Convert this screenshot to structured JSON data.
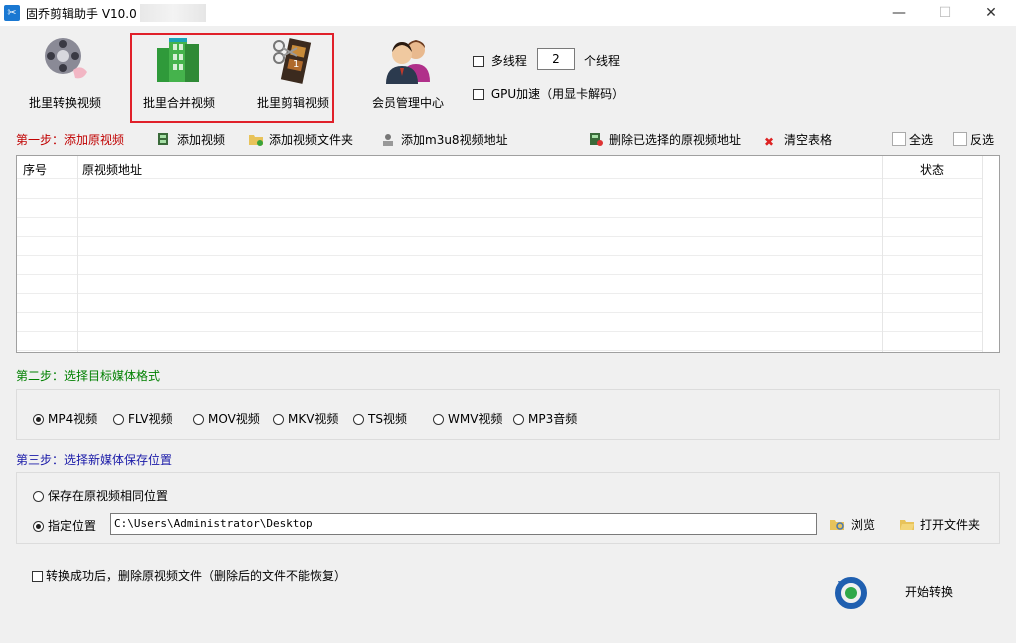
{
  "window": {
    "title": "固乔剪辑助手 V10.0"
  },
  "toolbar": {
    "batch_convert": "批里转换视频",
    "batch_merge": "批里合并视频",
    "batch_cut": "批里剪辑视频",
    "member_center": "会员管理中心",
    "multithread_label": "多线程",
    "thread_count": "2",
    "thread_unit": "个线程",
    "gpu_label": "GPU加速（用显卡解码）"
  },
  "step1": {
    "title": "第一步：添加原视频",
    "add_video": "添加视频",
    "add_folder": "添加视频文件夹",
    "add_m3u8": "添加m3u8视频地址",
    "delete_selected": "删除已选择的原视频地址",
    "clear_table": "清空表格",
    "select_all": "全选",
    "invert_select": "反选"
  },
  "table": {
    "columns": [
      "序号",
      "原视频地址",
      "状态"
    ],
    "rows": []
  },
  "step2": {
    "title": "第二步：选择目标媒体格式",
    "formats": [
      "MP4视频",
      "FLV视频",
      "MOV视频",
      "MKV视频",
      "TS视频",
      "WMV视频",
      "MP3音频"
    ],
    "selected": "MP4视频"
  },
  "step3": {
    "title": "第三步：选择新媒体保存位置",
    "same_location": "保存在原视频相同位置",
    "custom_location": "指定位置",
    "path": "C:\\Users\\Administrator\\Desktop",
    "browse": "浏览",
    "open_folder": "打开文件夹"
  },
  "footer": {
    "delete_after_label": "转换成功后，删除原视频文件（删除后的文件不能恢复）",
    "start_button": "开始转换"
  },
  "colors": {
    "step1": "#c00000",
    "step2": "#008000",
    "step3": "#1a1aa8",
    "highlight": "#e0202a"
  }
}
